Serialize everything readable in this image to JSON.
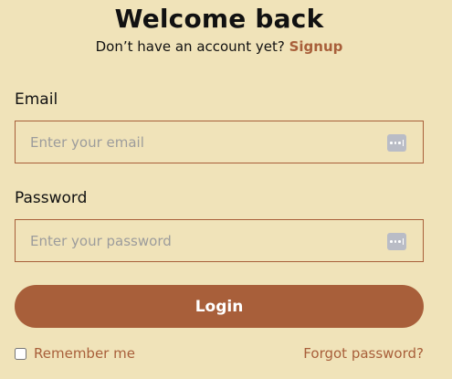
{
  "header": {
    "title": "Welcome back",
    "subtitle_text": "Don’t have an account yet?",
    "signup_link": "Signup"
  },
  "form": {
    "email": {
      "label": "Email",
      "placeholder": "Enter your email",
      "value": "",
      "icon": "password-manager-icon"
    },
    "password": {
      "label": "Password",
      "placeholder": "Enter your password",
      "value": "",
      "icon": "password-manager-icon"
    },
    "login_label": "Login",
    "remember_label": "Remember me",
    "remember_checked": false,
    "forgot_label": "Forgot password?"
  },
  "colors": {
    "background": "#f0e3b9",
    "accent": "#a85f3a",
    "text": "#111111",
    "placeholder": "#9c9c9c",
    "icon_bg": "#b9bcc6"
  }
}
